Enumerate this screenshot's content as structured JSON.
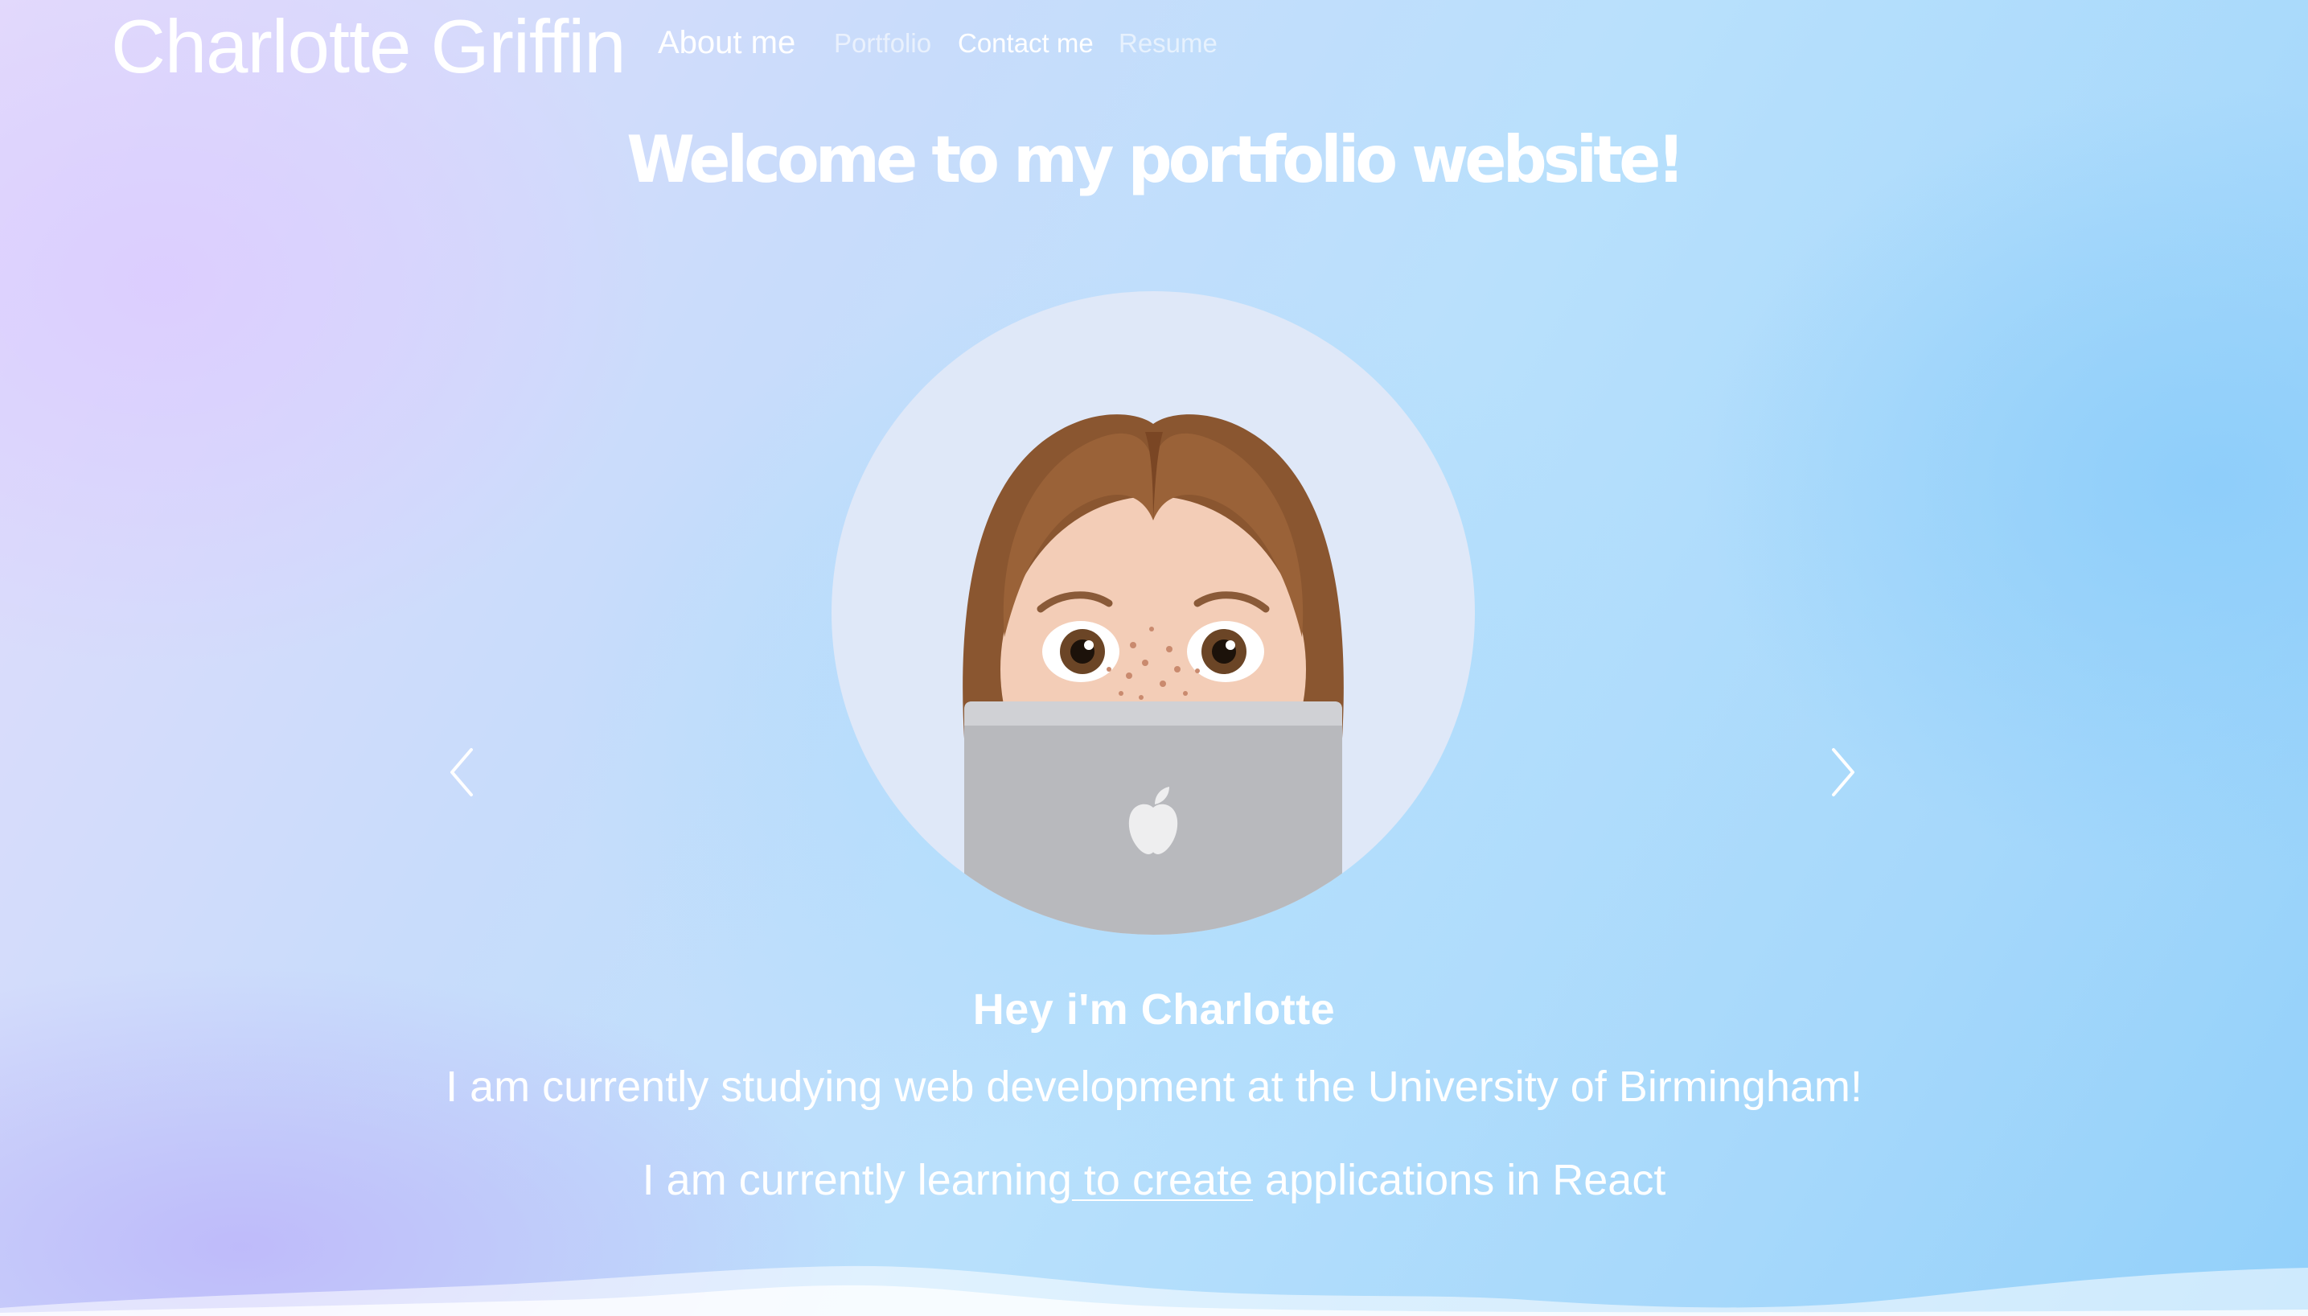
{
  "nav": {
    "brand": "Charlotte Griffin",
    "links": [
      {
        "label": "About me"
      },
      {
        "label": "Portfolio"
      },
      {
        "label": "Contact me"
      },
      {
        "label": "Resume"
      }
    ]
  },
  "hero": {
    "heading": "Welcome to my portfolio website!"
  },
  "carousel": {
    "avatar_icon": "memoji-avatar-with-laptop",
    "prev_icon": "chevron-left-icon",
    "next_icon": "chevron-right-icon",
    "caption_title": "Hey i'm Charlotte",
    "caption_line1": "I am currently studying web development at the University of Birmingham!",
    "caption_line2": {
      "part1": "I am currently learning",
      "part2": " to",
      "part3": " create",
      "part4": " applications in React"
    }
  },
  "colors": {
    "text": "#ffffff",
    "background_start": "#e4dcfb",
    "background_end": "#92d0fa",
    "avatar_bg": "#dfe8f8"
  }
}
